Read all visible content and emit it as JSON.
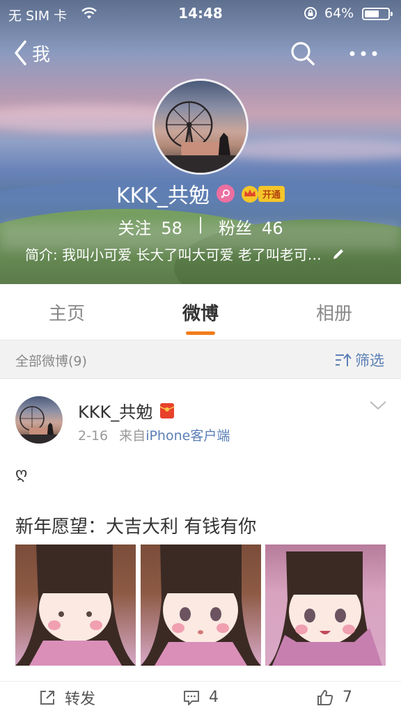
{
  "status_bar": {
    "carrier": "无 SIM 卡",
    "time": "14:48",
    "battery": "64%",
    "battery_level": 0.64
  },
  "nav": {
    "back_label": "我",
    "icons": [
      "chevron-left-icon",
      "search-icon",
      "more-icon"
    ]
  },
  "profile": {
    "name": "KKK_共勉",
    "vip_label": "开通",
    "following_label": "关注",
    "following_count": "58",
    "followers_label": "粉丝",
    "followers_count": "46",
    "bio": "简介: 我叫小可爱 长大了叫大可爱 老了叫老可…"
  },
  "tabs": [
    {
      "label": "主页",
      "active": false
    },
    {
      "label": "微博",
      "active": true
    },
    {
      "label": "相册",
      "active": false
    }
  ],
  "filter": {
    "count_label": "全部微博(9)",
    "filter_label": "筛选"
  },
  "post": {
    "author": "KKK_共勉",
    "date": "2-16",
    "source_prefix": "来自",
    "source": "iPhone客户端",
    "emoji_line": "ღ",
    "text": "新年愿望：大吉大利 有钱有你",
    "image_count": 3,
    "repost_label": "转发",
    "comment_count": "4",
    "like_count": "7"
  },
  "colors": {
    "accent_orange": "#f27c1b",
    "link_blue": "#5b7fb6",
    "vip_gold": "#f5c52a"
  }
}
